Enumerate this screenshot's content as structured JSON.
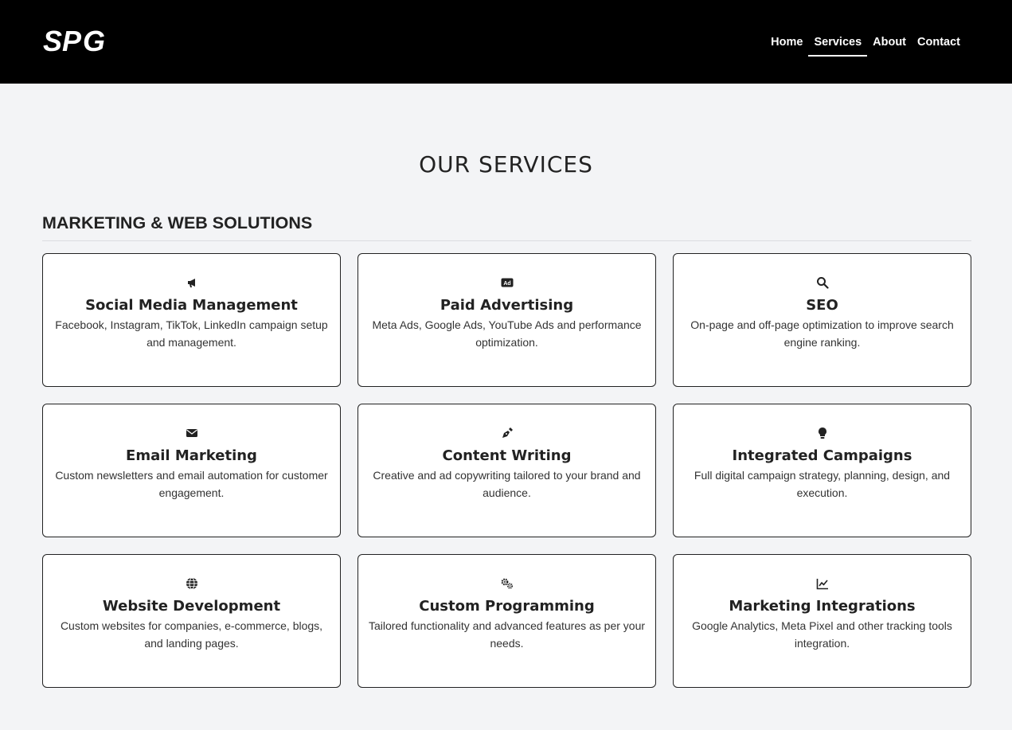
{
  "header": {
    "logo_text": "SPG",
    "nav": [
      {
        "label": "Home",
        "active": false
      },
      {
        "label": "Services",
        "active": true
      },
      {
        "label": "About",
        "active": false
      },
      {
        "label": "Contact",
        "active": false
      }
    ]
  },
  "page": {
    "title": "OUR SERVICES",
    "section_title": "MARKETING & WEB SOLUTIONS"
  },
  "services": [
    {
      "icon": "megaphone-icon",
      "title": "Social Media Management",
      "description": "Facebook, Instagram, TikTok, LinkedIn campaign setup and management."
    },
    {
      "icon": "ad-icon",
      "title": "Paid Advertising",
      "description": "Meta Ads, Google Ads, YouTube Ads and performance optimization."
    },
    {
      "icon": "search-icon",
      "title": "SEO",
      "description": "On-page and off-page optimization to improve search engine ranking."
    },
    {
      "icon": "envelope-icon",
      "title": "Email Marketing",
      "description": "Custom newsletters and email automation for customer engagement."
    },
    {
      "icon": "pen-nib-icon",
      "title": "Content Writing",
      "description": "Creative and ad copywriting tailored to your brand and audience."
    },
    {
      "icon": "lightbulb-icon",
      "title": "Integrated Campaigns",
      "description": "Full digital campaign strategy, planning, design, and execution."
    },
    {
      "icon": "globe-icon",
      "title": "Website Development",
      "description": "Custom websites for companies, e-commerce, blogs, and landing pages."
    },
    {
      "icon": "gears-icon",
      "title": "Custom Programming",
      "description": "Tailored functionality and advanced features as per your needs."
    },
    {
      "icon": "chart-line-icon",
      "title": "Marketing Integrations",
      "description": "Google Analytics, Meta Pixel and other tracking tools integration."
    }
  ]
}
